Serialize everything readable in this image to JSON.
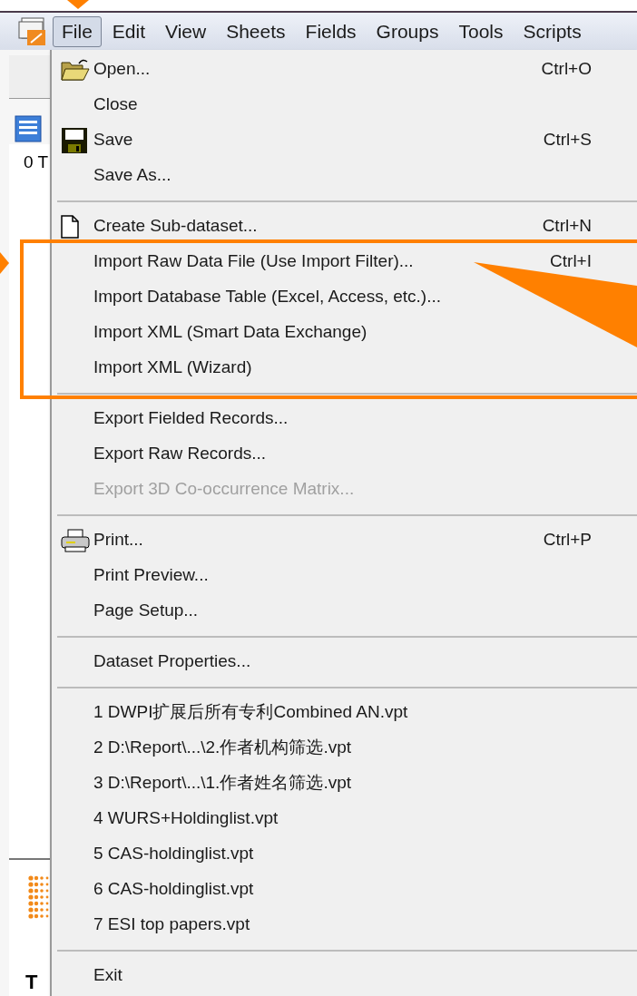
{
  "menubar": {
    "items": [
      {
        "label": "File",
        "selected": true
      },
      {
        "label": "Edit",
        "selected": false
      },
      {
        "label": "View",
        "selected": false
      },
      {
        "label": "Sheets",
        "selected": false
      },
      {
        "label": "Fields",
        "selected": false
      },
      {
        "label": "Groups",
        "selected": false
      },
      {
        "label": "Tools",
        "selected": false
      },
      {
        "label": "Scripts",
        "selected": false
      }
    ]
  },
  "background": {
    "texts": [
      "0 T",
      "T"
    ]
  },
  "menu": {
    "sections": [
      [
        {
          "label": "Open...",
          "shortcut": "Ctrl+O",
          "disabled": false
        },
        {
          "label": "Close",
          "disabled": false
        },
        {
          "label": "Save",
          "shortcut": "Ctrl+S",
          "disabled": false
        },
        {
          "label": "Save As...",
          "disabled": false
        }
      ],
      [
        {
          "label": "Create Sub-dataset...",
          "shortcut": "Ctrl+N",
          "disabled": false
        },
        {
          "label": "Import Raw Data File (Use Import Filter)...",
          "shortcut": "Ctrl+I",
          "disabled": false
        },
        {
          "label": "Import Database Table (Excel, Access, etc.)...",
          "disabled": false
        },
        {
          "label": "Import XML (Smart Data Exchange)",
          "disabled": false
        },
        {
          "label": "Import XML (Wizard)",
          "disabled": false
        }
      ],
      [
        {
          "label": "Export Fielded Records...",
          "disabled": false
        },
        {
          "label": "Export Raw Records...",
          "disabled": false
        },
        {
          "label": "Export 3D Co-occurrence Matrix...",
          "disabled": true
        }
      ],
      [
        {
          "label": "Print...",
          "shortcut": "Ctrl+P",
          "disabled": false
        },
        {
          "label": "Print Preview...",
          "disabled": false
        },
        {
          "label": "Page Setup...",
          "disabled": false
        }
      ],
      [
        {
          "label": "Dataset Properties...",
          "disabled": false
        }
      ],
      [
        {
          "label": "1 DWPI扩展后所有专利Combined AN.vpt",
          "disabled": false
        },
        {
          "label": "2 D:\\Report\\...\\2.作者机构筛选.vpt",
          "disabled": false
        },
        {
          "label": "3 D:\\Report\\...\\1.作者姓名筛选.vpt",
          "disabled": false
        },
        {
          "label": "4 WURS+Holdinglist.vpt",
          "disabled": false
        },
        {
          "label": "5 CAS-holdinglist.vpt",
          "disabled": false
        },
        {
          "label": "6 CAS-holdinglist.vpt",
          "disabled": false
        },
        {
          "label": "7 ESI top papers.vpt",
          "disabled": false
        }
      ],
      [
        {
          "label": "Exit",
          "disabled": false
        }
      ]
    ]
  }
}
